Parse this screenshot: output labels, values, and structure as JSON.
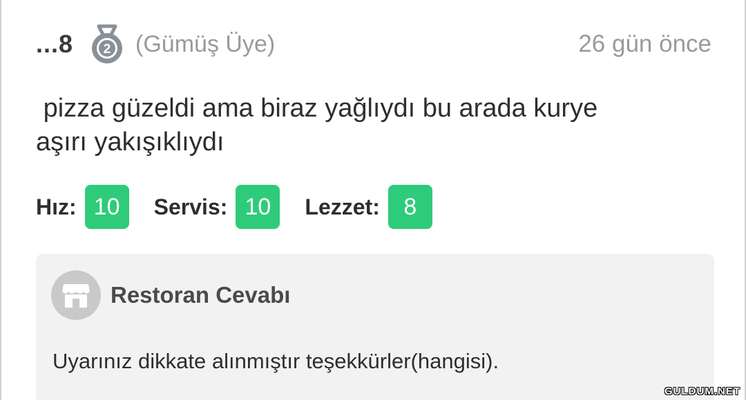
{
  "review": {
    "username": "...8",
    "medal_icon": "silver-medal-icon",
    "medal_number": "2",
    "member_type": "(Gümüş Üye)",
    "time_ago": "26 gün önce",
    "text": " pizza güzeldi ama biraz yağlıydı bu arada kurye\naşırı yakışıklıydı"
  },
  "ratings": [
    {
      "label": "Hız:",
      "score": "10"
    },
    {
      "label": "Servis:",
      "score": "10"
    },
    {
      "label": "Lezzet:",
      "score": "8"
    }
  ],
  "restaurant_reply": {
    "icon": "store-icon",
    "title": "Restoran Cevabı",
    "text": "Uyarınız dikkate alınmıştır teşekkürler(hangisi)."
  },
  "watermark": "GULDUM.NET",
  "colors": {
    "score_badge": "#2ecc7a",
    "reply_background": "#f2f2f2",
    "muted_text": "#9a9a9a",
    "medal": "#8a9099"
  }
}
